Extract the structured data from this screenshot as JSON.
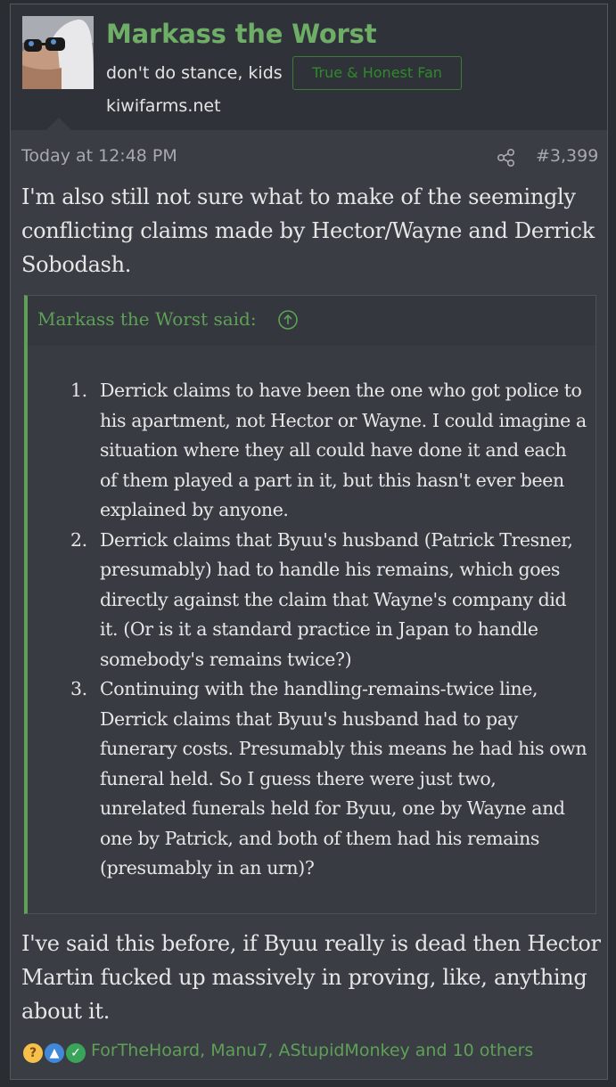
{
  "user": {
    "name": "Markass the Worst",
    "title": "don't do stance, kids",
    "banner": "True & Honest Fan",
    "extra": "kiwifarms.net"
  },
  "meta": {
    "date": "Today at 12:48 PM",
    "post_number": "#3,399"
  },
  "body": {
    "intro": "I'm also still not sure what to make of the seemingly conflicting claims made by Hector/Wayne and Derrick Sobodash.",
    "outro": "I've said this before, if Byuu really is dead then Hector Martin fucked up massively in proving, like, anything about it."
  },
  "quote": {
    "author": "Markass the Worst said:",
    "items": [
      {
        "num": "1.",
        "text": "Derrick claims to have been the one who got police to his apartment, not Hector or Wayne. I could imagine a situation where they all could have done it and each of them played a part in it, but this hasn't ever been explained by anyone."
      },
      {
        "num": "2.",
        "text": "Derrick claims that Byuu's husband (Patrick Tresner, presumably) had to handle his remains, which goes directly against the claim that Wayne's company did it. (Or is it a standard practice in Japan to handle somebody's remains twice?)"
      },
      {
        "num": "3.",
        "text": "Continuing with the handling-remains-twice line, Derrick claims that Byuu's husband had to pay funerary costs. Presumably this means he had his own funeral held. So I guess there were just two, unrelated funerals held for Byuu, one by Wayne and one by Patrick, and both of them had his remains (presumably in an urn)?"
      }
    ]
  },
  "reactions": {
    "icons": [
      "thinking-icon",
      "like-icon",
      "agree-icon"
    ],
    "users_text": "ForTheHoard, Manu7, AStupidMonkey and 10 others"
  },
  "colors": {
    "accent_green": "#5ea156",
    "background": "#2a2d32",
    "post_bg": "#3a3d44"
  }
}
